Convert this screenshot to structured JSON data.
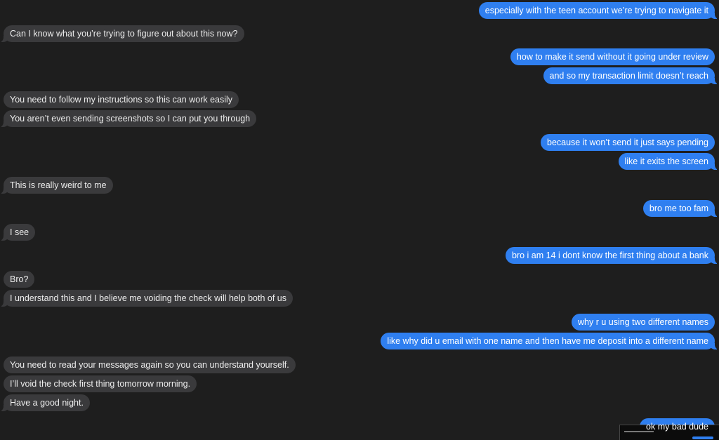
{
  "conversation": {
    "messages": [
      {
        "side": "out",
        "text": "especially with the teen account we’re trying to navigate it"
      },
      {
        "side": "in",
        "text": "Can I know what you’re trying to figure out about this now?"
      },
      {
        "side": "out",
        "text": "how to make it send without it going under review"
      },
      {
        "side": "out",
        "text": "and so my transaction limit doesn’t reach"
      },
      {
        "side": "in",
        "text": "You need to  follow my instructions so this can work easily"
      },
      {
        "side": "in",
        "text": "You aren’t even sending screenshots so I can put you through"
      },
      {
        "side": "out",
        "text": "because it won’t send it just says pending"
      },
      {
        "side": "out",
        "text": "like it exits the screen"
      },
      {
        "side": "in",
        "text": "This is really weird to me"
      },
      {
        "side": "out",
        "text": "bro me too fam"
      },
      {
        "side": "in",
        "text": "I see"
      },
      {
        "side": "out",
        "text": "bro i am 14 i dont know the first thing about a bank"
      },
      {
        "side": "in",
        "text": "Bro?"
      },
      {
        "side": "in",
        "text": "I understand this and I believe me voiding the check will help both of us"
      },
      {
        "side": "out",
        "text": "why r u using two different names"
      },
      {
        "side": "out",
        "text": "like why did u email with one name and then have me deposit into a different name"
      },
      {
        "side": "in",
        "text": " You need to read your messages again so you can understand yourself."
      },
      {
        "side": "in",
        "text": "I’ll void the check first thing tomorrow morning."
      },
      {
        "side": "in",
        "text": "Have a good night."
      },
      {
        "side": "out",
        "text": "ok my bad dude"
      }
    ]
  },
  "colors": {
    "background": "#1e1e1e",
    "incoming_bubble": "#3a3a3c",
    "outgoing_bubble": "#2f7ff0"
  }
}
